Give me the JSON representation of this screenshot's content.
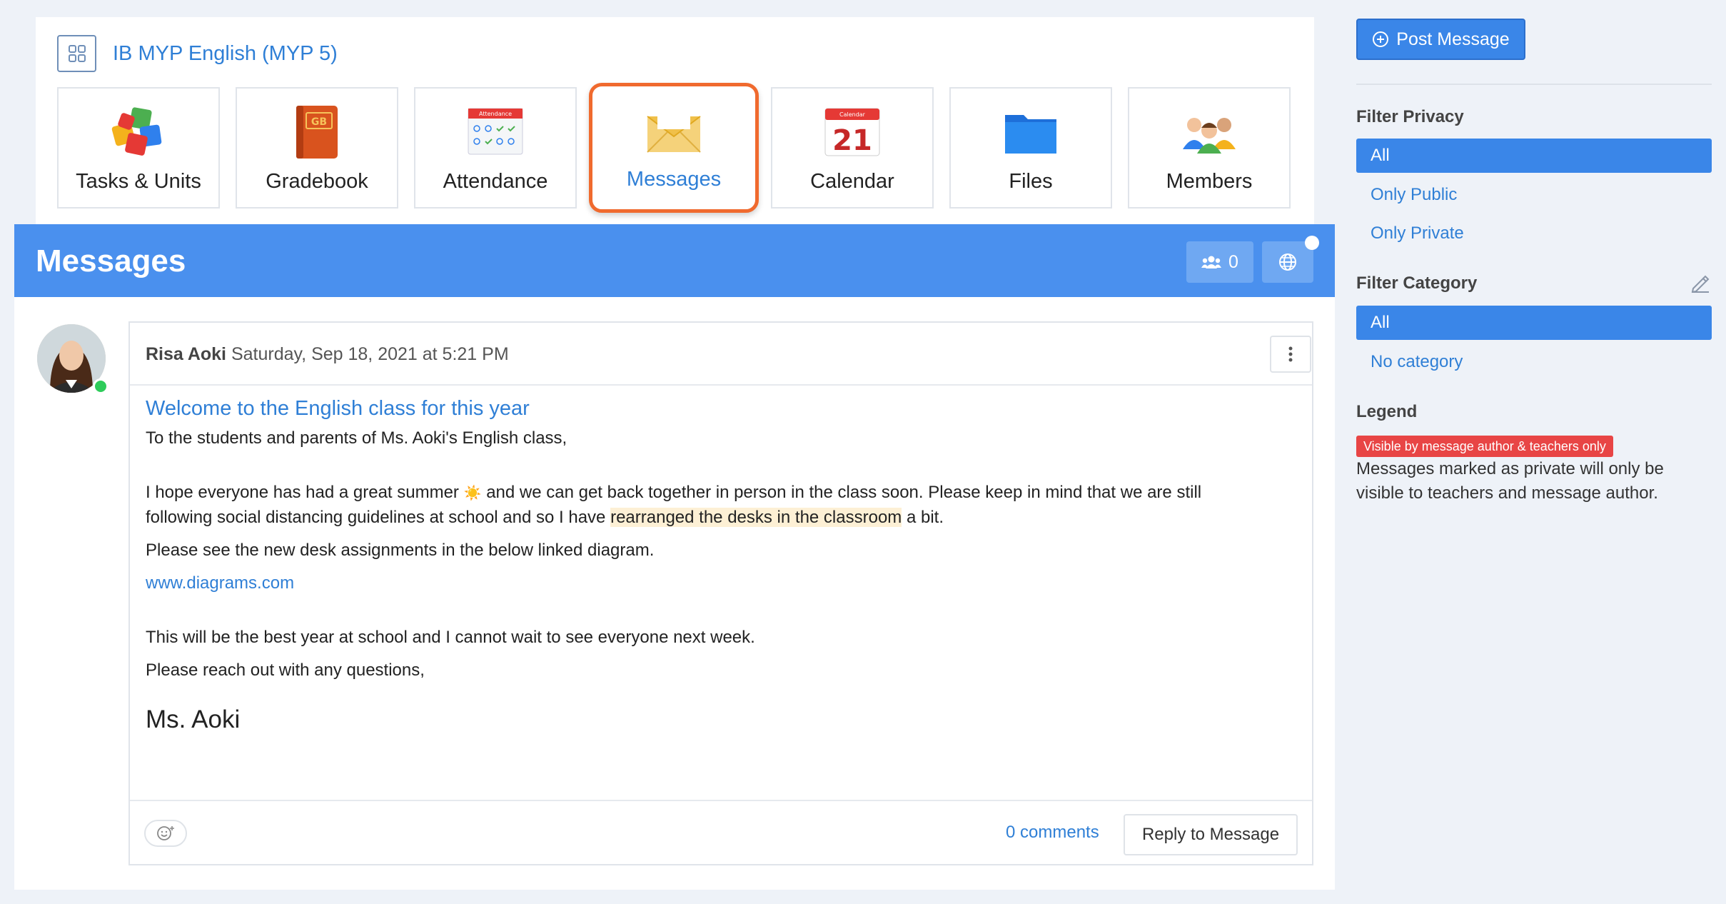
{
  "course": {
    "title": "IB MYP English (MYP 5)",
    "tiles": [
      {
        "label": "Tasks & Units",
        "icon": "puzzle-icon"
      },
      {
        "label": "Gradebook",
        "icon": "gradebook-icon",
        "badge": "GB"
      },
      {
        "label": "Attendance",
        "icon": "attendance-icon",
        "badge": "Attendance"
      },
      {
        "label": "Messages",
        "icon": "envelope-icon",
        "active": true
      },
      {
        "label": "Calendar",
        "icon": "calendar-icon",
        "badge": "Calendar",
        "day": "21"
      },
      {
        "label": "Files",
        "icon": "folder-icon"
      },
      {
        "label": "Members",
        "icon": "members-icon"
      }
    ]
  },
  "panel": {
    "title": "Messages",
    "members_count": "0"
  },
  "message": {
    "author": "Risa Aoki",
    "timestamp": "Saturday, Sep 18, 2021 at 5:21 PM",
    "subject": "Welcome to the English class for this year",
    "greeting": "To the students and parents of Ms. Aoki's English class,",
    "para1_line1_a": "I hope everyone has had a great summer",
    "sun_emoji": "☀️",
    "para1_line1_b": "and we can get back together in person in the class soon. Please keep in mind that we are still",
    "para1_line2_a": "following social distancing guidelines at school and so I have",
    "para1_highlight": "rearranged the desks in the classroom",
    "para1_line2_b": "a bit.",
    "para2": "Please see the new desk assignments in the below linked diagram.",
    "link": "www.diagrams.com",
    "para3": "This will be the best year at school and I cannot wait to see everyone next week.",
    "para4": "Please reach out with any questions,",
    "signature": "Ms. Aoki",
    "comments": "0 comments",
    "reply_label": "Reply to Message"
  },
  "sidebar": {
    "post_label": "Post Message",
    "filter_privacy_title": "Filter Privacy",
    "privacy_options": [
      "All",
      "Only Public",
      "Only Private"
    ],
    "filter_category_title": "Filter Category",
    "category_options": [
      "All",
      "No category"
    ],
    "legend_title": "Legend",
    "legend_badge": "Visible by message author & teachers only",
    "legend_text": "Messages marked as private will only be visible to teachers and message author."
  },
  "colors": {
    "accent": "#4a90ee",
    "active_border": "#f06a2e",
    "link": "#2f7fd6",
    "online": "#2ecc5a",
    "private_badge": "#e84545"
  }
}
